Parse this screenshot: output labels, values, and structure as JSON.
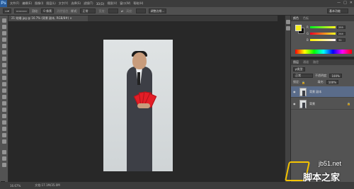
{
  "app": {
    "logo": "Ps"
  },
  "menu": [
    "文件(F)",
    "编辑(E)",
    "图像(I)",
    "图层(L)",
    "文字(Y)",
    "选择(S)",
    "滤镜(T)",
    "3D(D)",
    "视图(V)",
    "窗口(W)",
    "帮助(H)"
  ],
  "window_controls": [
    "—",
    "□",
    "✕"
  ],
  "options": {
    "feather_label": "羽化:",
    "feather_value": "0 像素",
    "antialias_label": "消除锯齿",
    "style_label": "样式:",
    "style_value": "正常",
    "width_label": "宽度:",
    "height_label": "高度:",
    "refine_edge": "调整边缘...",
    "workspace": "基本功能"
  },
  "document_tab": "21 结婚.jpg @ 16.7% (背景 副本, RGB/8#) ×",
  "status": {
    "zoom": "16.67%",
    "doc_size": "文档:17.1M/35.0M"
  },
  "color_panel": {
    "tabs": [
      "颜色",
      "色板"
    ],
    "fg_color": "#f5ed1e",
    "bg_color": "#111111",
    "r": {
      "label": "R",
      "value": "255"
    },
    "g": {
      "label": "G",
      "value": "244"
    },
    "b": {
      "label": "B",
      "value": "31"
    }
  },
  "layers_panel": {
    "tabs": [
      "图层",
      "通道",
      "路径"
    ],
    "filter_label": "ρ类型",
    "blend_mode": "正常",
    "opacity_label": "不透明度:",
    "opacity_value": "100%",
    "lock_label": "锁定:",
    "fill_label": "填充:",
    "fill_value": "100%",
    "layers": [
      {
        "name": "背景 副本",
        "selected": true
      },
      {
        "name": "背景",
        "selected": false
      }
    ]
  },
  "watermark": {
    "url": "jb51.net",
    "text": "脚本之家"
  }
}
